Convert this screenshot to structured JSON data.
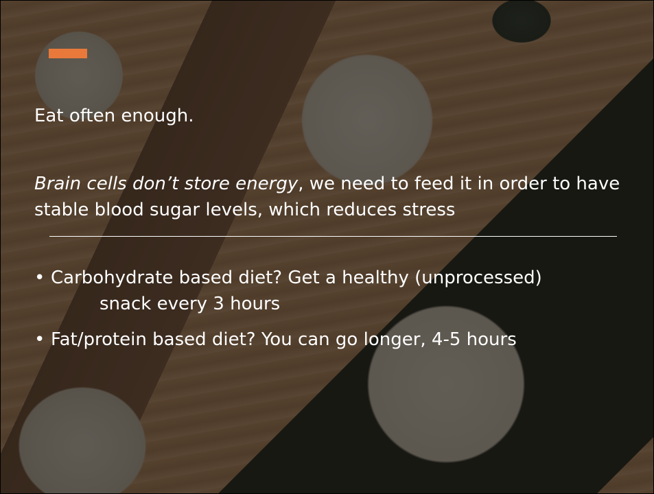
{
  "slide": {
    "heading": "Eat often enough.",
    "paragraph": {
      "italic_part": "Brain cells don’t store energy",
      "rest": ", we need to feed it in order to have stable blood sugar levels, which reduces stress"
    },
    "bullets": [
      {
        "glyph": "•",
        "line1": "Carbohydrate based diet? Get a healthy (unprocessed)",
        "line2": "snack every 3 hours"
      },
      {
        "glyph": "•",
        "line1": "Fat/protein based diet? You can go longer, 4-5 hours"
      }
    ],
    "colors": {
      "accent": "#e8793a",
      "text": "#ffffff"
    }
  }
}
